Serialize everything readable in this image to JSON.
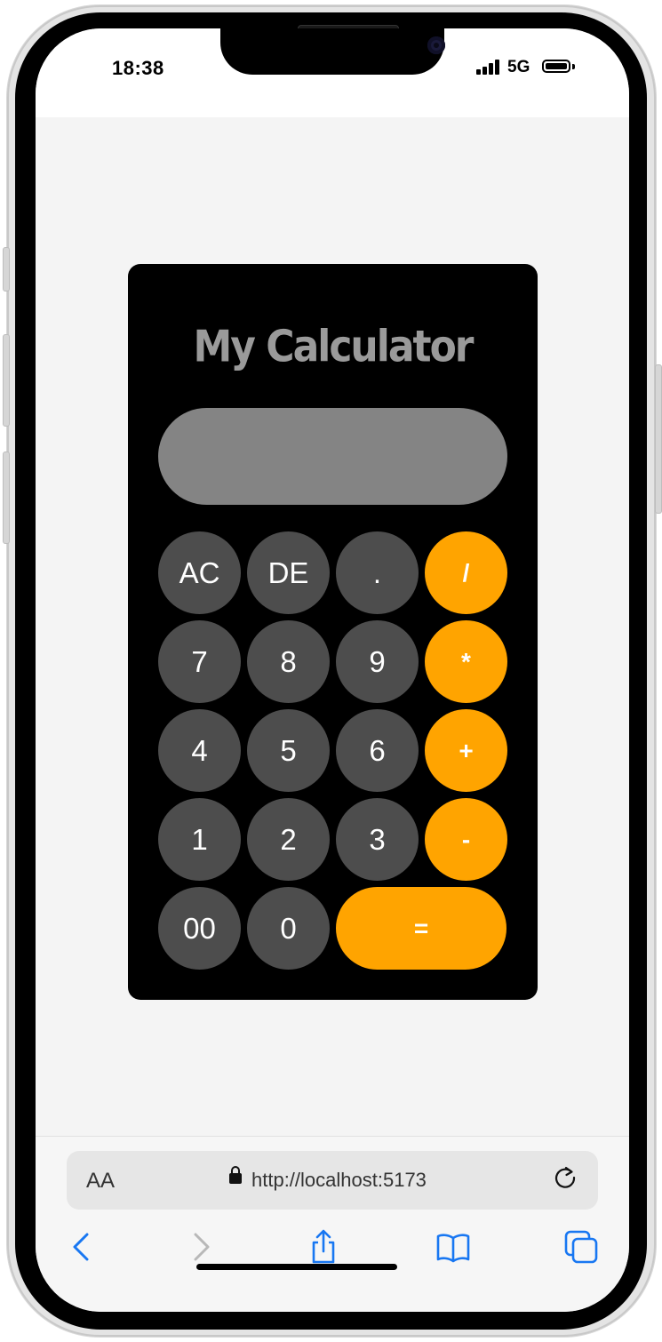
{
  "status_bar": {
    "time": "18:38",
    "network": "5G"
  },
  "calculator": {
    "title": "My Calculator",
    "display_value": "",
    "keys": [
      {
        "label": "AC",
        "kind": "function"
      },
      {
        "label": "DE",
        "kind": "function"
      },
      {
        "label": ".",
        "kind": "function"
      },
      {
        "label": "/",
        "kind": "operator"
      },
      {
        "label": "7",
        "kind": "digit"
      },
      {
        "label": "8",
        "kind": "digit"
      },
      {
        "label": "9",
        "kind": "digit"
      },
      {
        "label": "*",
        "kind": "operator"
      },
      {
        "label": "4",
        "kind": "digit"
      },
      {
        "label": "5",
        "kind": "digit"
      },
      {
        "label": "6",
        "kind": "digit"
      },
      {
        "label": "+",
        "kind": "operator"
      },
      {
        "label": "1",
        "kind": "digit"
      },
      {
        "label": "2",
        "kind": "digit"
      },
      {
        "label": "3",
        "kind": "digit"
      },
      {
        "label": "-",
        "kind": "operator"
      },
      {
        "label": "00",
        "kind": "digit"
      },
      {
        "label": "0",
        "kind": "digit"
      },
      {
        "label": "=",
        "kind": "equals"
      }
    ],
    "colors": {
      "body": "#000000",
      "title": "#9a9a9a",
      "display": "#848484",
      "key_dark": "#4d4d4d",
      "key_operator": "#ffa400"
    }
  },
  "browser": {
    "text_size_label": "AA",
    "url": "http://localhost:5173",
    "icons": [
      "lock-icon",
      "reload-icon",
      "back-icon",
      "forward-icon",
      "share-icon",
      "bookmarks-icon",
      "tabs-icon"
    ],
    "accent_color": "#1877f2"
  }
}
